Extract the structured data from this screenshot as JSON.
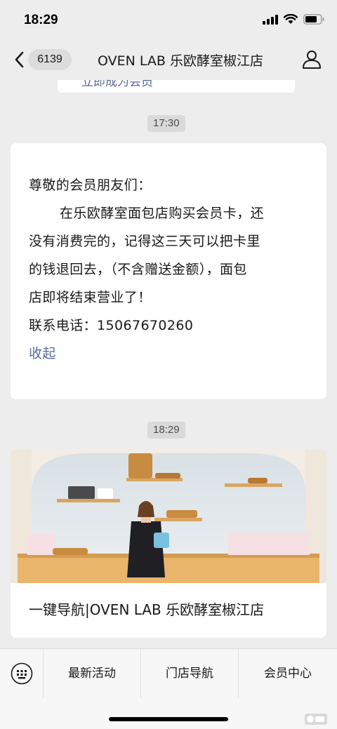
{
  "status_bar": {
    "time": "18:29"
  },
  "nav": {
    "unread_count": "6139",
    "title": "OVEN LAB 乐欧酵室椒江店"
  },
  "chat": {
    "previous_card_text": "立即成为会员",
    "timestamp_1": "17:30",
    "message": {
      "greeting": "尊敬的会员朋友们：",
      "line_1": "在乐欧酵室面包店购买会员卡，还",
      "line_2": "没有消费完的，记得这三天可以把卡里",
      "line_3": "的钱退回去，（不含赠送金额），面包",
      "line_4": "店即将结束营业了！",
      "contact": "联系电话：15067670260",
      "collapse_label": "收起"
    },
    "timestamp_2": "18:29",
    "article": {
      "title": "一键导航|OVEN LAB 乐欧酵室椒江店"
    }
  },
  "menu": {
    "items": [
      "最新活动",
      "门店导航",
      "会员中心"
    ]
  },
  "colors": {
    "background": "#ededed",
    "link": "#576b95",
    "card": "#ffffff"
  }
}
